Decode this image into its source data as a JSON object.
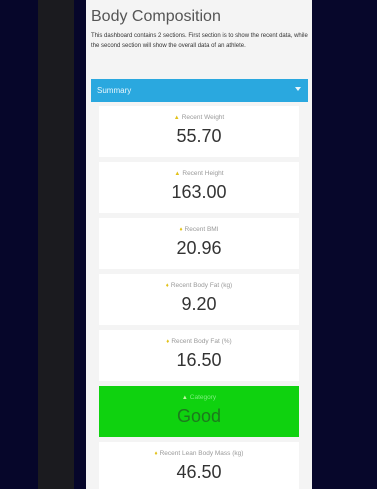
{
  "header": {
    "title": "Body Composition",
    "description": "This dashboard contains 2 sections. First section is to show the recent data, while the second section will show the overall data of an athlete."
  },
  "dropdown": {
    "selected": "Summary"
  },
  "cards": [
    {
      "label": "Recent Weight",
      "value": "55.70"
    },
    {
      "label": "Recent Height",
      "value": "163.00"
    },
    {
      "label": "Recent BMI",
      "value": "20.96"
    },
    {
      "label": "Recent Body Fat (kg)",
      "value": "9.20"
    },
    {
      "label": "Recent Body Fat (%)",
      "value": "16.50"
    },
    {
      "label": "Category",
      "value": "Good"
    },
    {
      "label": "Recent Lean Body Mass (kg)",
      "value": "46.50"
    }
  ],
  "colors": {
    "accent": "#2aa8df",
    "good": "#0fd20f",
    "icon": "#e2c21a"
  }
}
